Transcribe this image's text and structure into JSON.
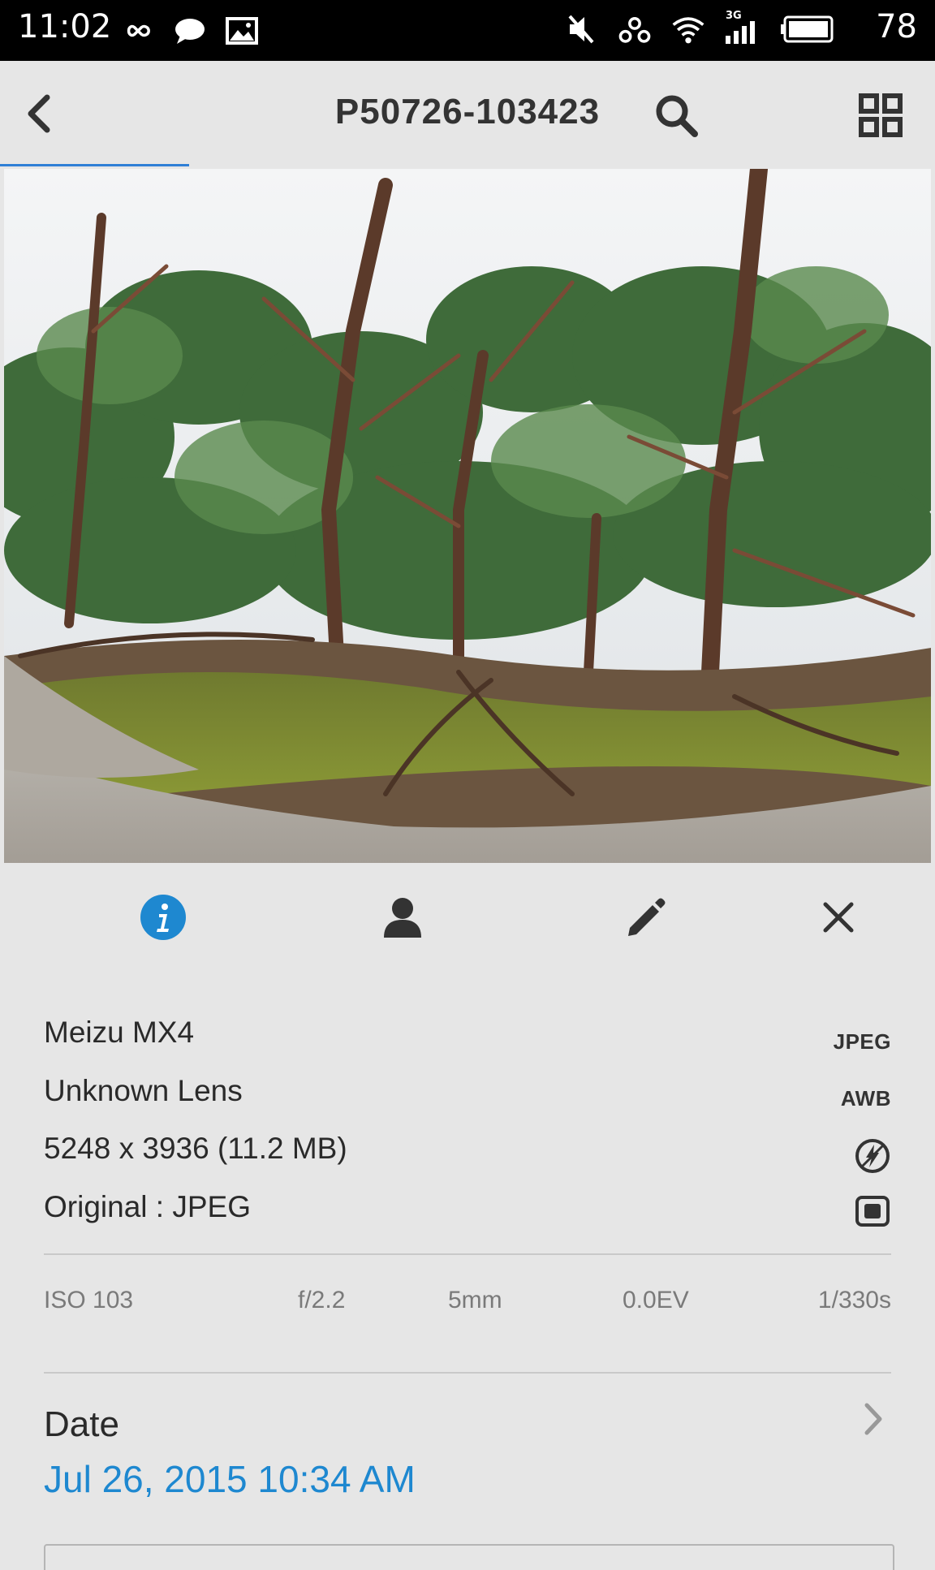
{
  "status_bar": {
    "time": "11:02",
    "battery_percent": "78",
    "network": "3G",
    "left_icons": [
      "infinity-icon",
      "chat-bubble-icon",
      "image-icon"
    ],
    "right_icons": [
      "mute-icon",
      "hotspot-icon",
      "wifi-icon",
      "signal-icon",
      "battery-icon"
    ]
  },
  "app_bar": {
    "title": "P50726-103423",
    "loading_progress": 0.2
  },
  "tabs": [
    {
      "name": "info",
      "icon": "info-icon",
      "active": true
    },
    {
      "name": "people",
      "icon": "person-icon",
      "active": false
    },
    {
      "name": "edit",
      "icon": "pencil-icon",
      "active": false
    },
    {
      "name": "close",
      "icon": "close-icon",
      "active": false
    }
  ],
  "info": {
    "camera": "Meizu MX4",
    "lens": "Unknown Lens",
    "dimensions": "5248 x 3936 (11.2 MB)",
    "original": "Original : JPEG",
    "badges": {
      "format": "JPEG",
      "white_balance": "AWB",
      "flash_icon": "flash-off-icon",
      "metering_icon": "metering-icon"
    }
  },
  "exif": {
    "iso": "ISO 103",
    "aperture": "f/2.2",
    "focal_length": "5mm",
    "exposure_comp": "0.0EV",
    "shutter": "1/330s"
  },
  "date": {
    "label": "Date",
    "value": "Jul 26, 2015 10:34 AM"
  },
  "colors": {
    "accent": "#1e88d0",
    "background": "#e6e6e6",
    "status_bar": "#000000"
  }
}
